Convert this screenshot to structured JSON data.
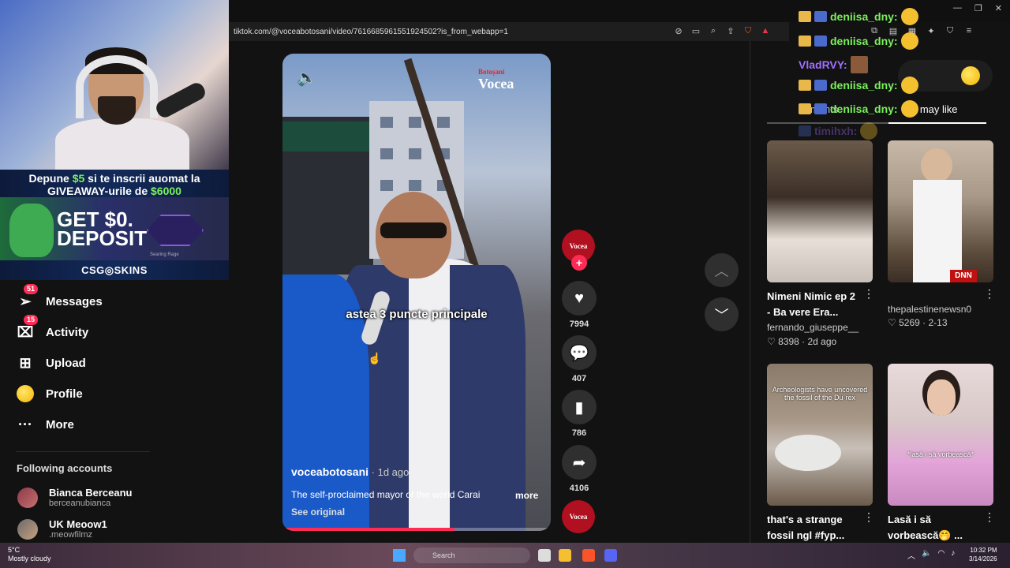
{
  "browser": {
    "url": "tiktok.com/@voceabotosani/video/7616685961551924502?is_from_webapp=1",
    "win_minimize": "—",
    "win_restore": "❐",
    "win_close": "✕"
  },
  "stream_overlay": {
    "promo_line1_pre": "Depune ",
    "promo_line1_amount": "$5",
    "promo_line1_post": " si te inscrii auomat la",
    "promo_line2_pre": "GIVEAWAY-urile de ",
    "promo_line2_amount": "$6000",
    "promo_get": "GET $0.",
    "promo_deposit": "DEPOSIT",
    "promo_skin": "Searing Rage",
    "promo_brand": "CSG◎SKINS"
  },
  "sidebar": {
    "items": [
      {
        "label": "Messages",
        "icon": "paper-plane-icon",
        "badge": "51"
      },
      {
        "label": "Activity",
        "icon": "inbox-icon",
        "badge": "15"
      },
      {
        "label": "Upload",
        "icon": "plus-square-icon"
      },
      {
        "label": "Profile",
        "icon": "profile-avatar"
      },
      {
        "label": "More",
        "icon": "more-dots-icon"
      }
    ],
    "following_title": "Following accounts",
    "accounts": [
      {
        "name": "Bianca Berceanu",
        "handle": "berceanubianca"
      },
      {
        "name": "UK Meoow1",
        "handle": ".meowfilmz"
      }
    ]
  },
  "video": {
    "logo_top": "Botoșani",
    "logo_main": "Vocea",
    "caption": "astea 3 puncte principale",
    "author": "voceabotosani",
    "time": " · 1d ago",
    "description": "The self-proclaimed mayor of the world Carai",
    "more": "more",
    "see_original": "See original",
    "progress_percent": 64
  },
  "actions": {
    "likes": "7994",
    "comments": "407",
    "saves": "786",
    "shares": "4106"
  },
  "chat": {
    "lines": [
      {
        "user": "deniisa_dny:"
      },
      {
        "user": "deniisa_dny:"
      },
      {
        "user": "VladRVY:"
      },
      {
        "user": "deniisa_dny:"
      },
      {
        "user": "deniisa_dny:"
      },
      {
        "user": "timihxh:"
      }
    ],
    "user_color_green": "#7cf05c",
    "user_color_purple": "#a070ff"
  },
  "right_panel": {
    "tab_comments": "mments",
    "tab_like": "u may like"
  },
  "recommendations": [
    {
      "title_line1": "Nimeni Nimic ep 2",
      "title_line2": "- Ba vere Era...",
      "author": "fernando_giuseppe__",
      "likes": "8398",
      "date": "2d ago"
    },
    {
      "title_line1": "thepalestinenewsn0",
      "title_line2": "",
      "author": "",
      "likes": "5269",
      "date": "2-13",
      "badge": "DNN"
    },
    {
      "title_line1": "that's a strange",
      "title_line2": "fossil ngl #fyp...",
      "overlay": "Archeologists have uncovered the fossil of the Du·rex"
    },
    {
      "title_line1": "Lasă i să",
      "title_line2": "vorbească🤭 ...",
      "overlay": "*lasă i să vorbească*"
    }
  ],
  "taskbar": {
    "temp": "5°C",
    "weather": "Mostly cloudy",
    "search": "Search",
    "time": "10:32 PM",
    "date": "3/14/2026"
  }
}
